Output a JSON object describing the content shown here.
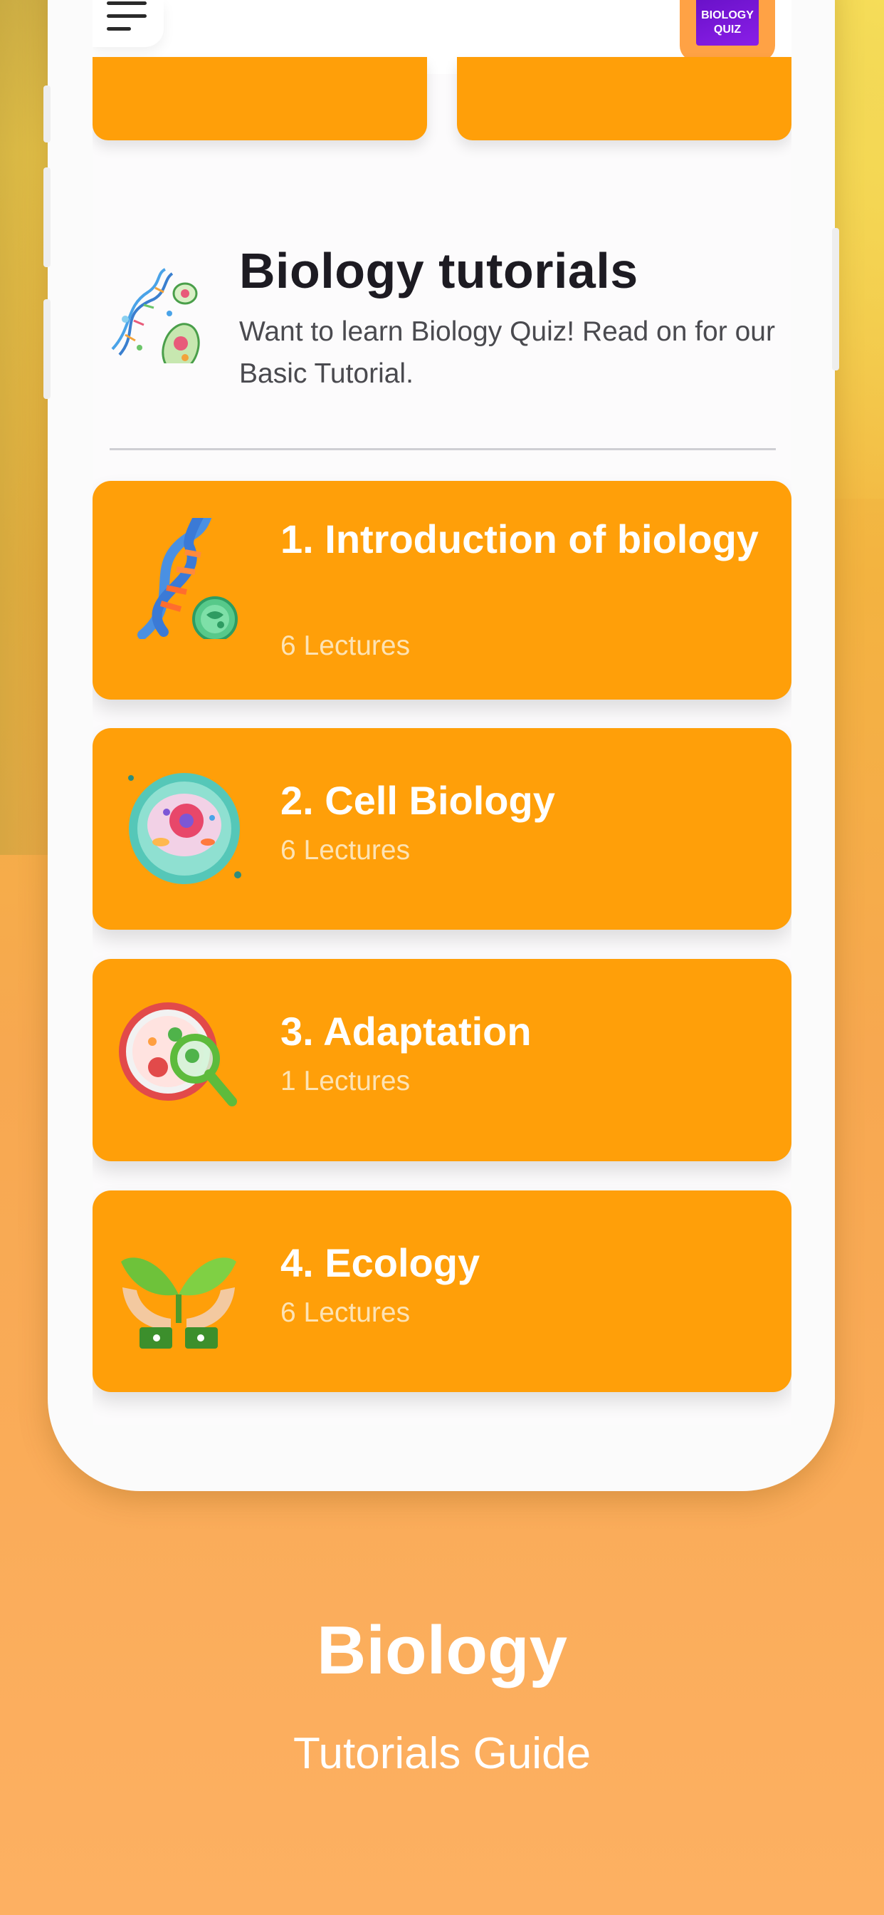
{
  "header": {
    "menu_icon": "menu-icon",
    "logo_line1": "BIOLOGY",
    "logo_line2": "QUIZ",
    "icon": "dna-cells-icon",
    "title": "Biology tutorials",
    "subtitle": "Want to learn Biology Quiz! Read on for our Basic Tutorial."
  },
  "lessons": [
    {
      "title": "1. Introduction of biology",
      "count": "6 Lectures",
      "icon": "dna-helix-icon"
    },
    {
      "title": "2. Cell Biology",
      "count": "6 Lectures",
      "icon": "animal-cell-icon"
    },
    {
      "title": "3. Adaptation",
      "count": "1 Lectures",
      "icon": "magnifier-petri-icon"
    },
    {
      "title": "4. Ecology",
      "count": "6 Lectures",
      "icon": "hands-sprout-icon"
    }
  ],
  "footer": {
    "title": "Biology",
    "subtitle": "Tutorials Guide"
  },
  "colors": {
    "card": "#ff9f09",
    "accent_badge": "#ffa245",
    "logo": "#7a16d8",
    "text_dark": "#1d1b22"
  }
}
